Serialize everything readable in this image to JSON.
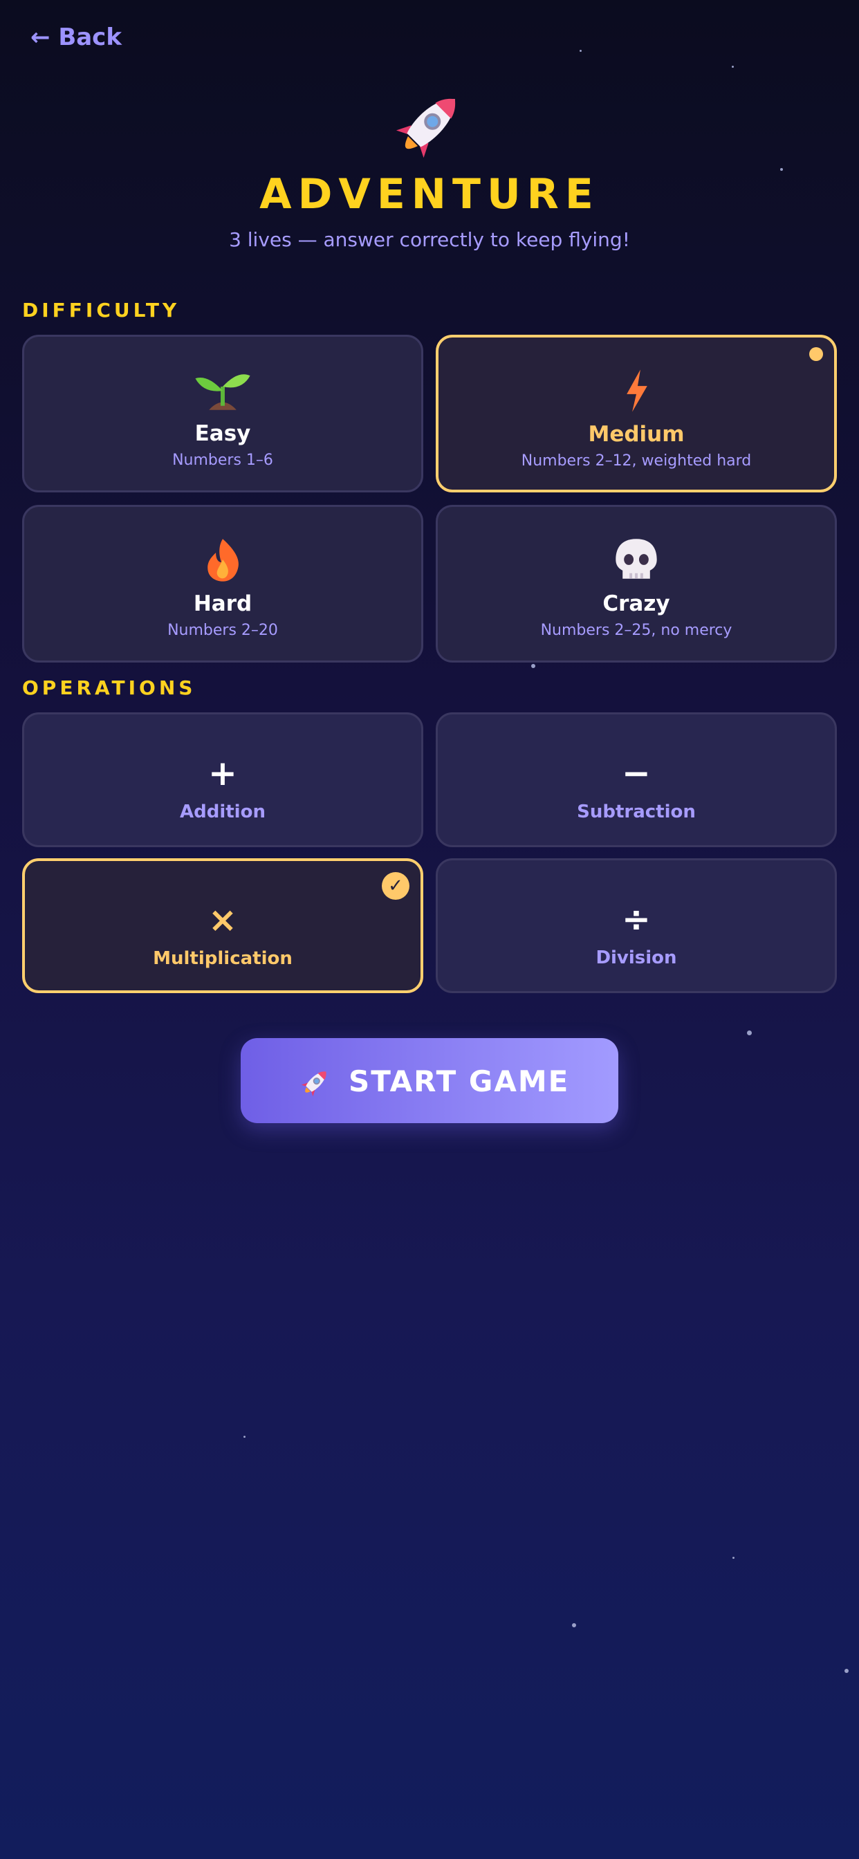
{
  "nav": {
    "back_label": "← Back"
  },
  "header": {
    "icon": "rocket-icon",
    "title": "ADVENTURE",
    "subtitle": "3 lives — answer correctly to keep flying!"
  },
  "difficulty": {
    "heading": "DIFFICULTY",
    "selected": "Medium",
    "options": [
      {
        "icon": "seedling-icon",
        "label": "Easy",
        "desc": "Numbers 1–6"
      },
      {
        "icon": "lightning-icon",
        "label": "Medium",
        "desc": "Numbers 2–12, weighted hard"
      },
      {
        "icon": "fire-icon",
        "label": "Hard",
        "desc": "Numbers 2–20"
      },
      {
        "icon": "skull-icon",
        "label": "Crazy",
        "desc": "Numbers 2–25, no mercy"
      }
    ]
  },
  "operations": {
    "heading": "OPERATIONS",
    "selected": [
      "Multiplication"
    ],
    "options": [
      {
        "symbol": "+",
        "label": "Addition"
      },
      {
        "symbol": "−",
        "label": "Subtraction"
      },
      {
        "symbol": "×",
        "label": "Multiplication"
      },
      {
        "symbol": "÷",
        "label": "Division"
      }
    ]
  },
  "start_button": {
    "label": "START GAME",
    "icon": "rocket-icon"
  },
  "colors": {
    "accent_yellow": "#ffd21f",
    "accent_purple": "#a79cff",
    "selected_border": "#ffcf6e",
    "card_bg": "#262445",
    "button_gradient_start": "#6f5fe6",
    "button_gradient_end": "#a29bff"
  }
}
